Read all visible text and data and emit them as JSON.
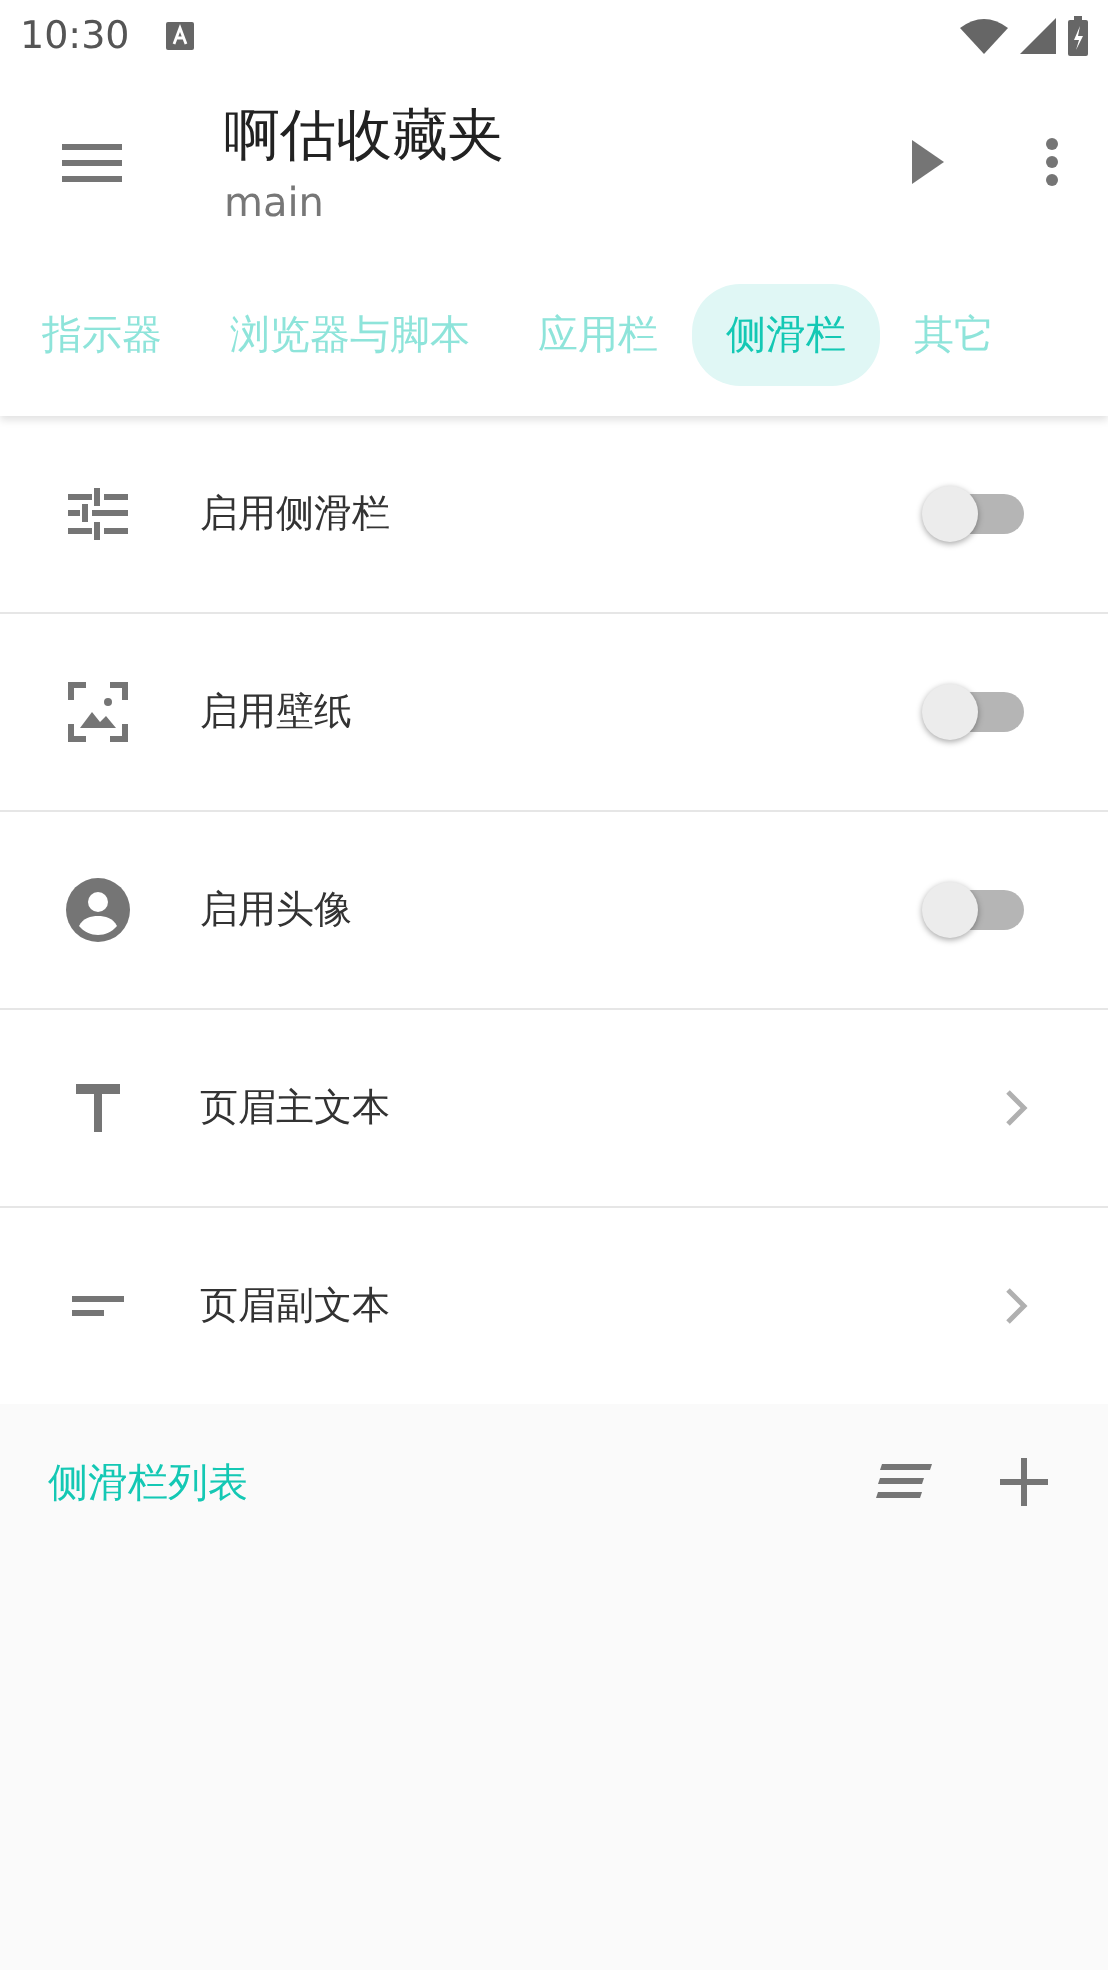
{
  "status_bar": {
    "time": "10:30"
  },
  "app_bar": {
    "title": "啊估收藏夹",
    "subtitle": "main"
  },
  "tabs": [
    {
      "label": "指示器",
      "selected": false
    },
    {
      "label": "浏览器与脚本",
      "selected": false
    },
    {
      "label": "应用栏",
      "selected": false
    },
    {
      "label": "侧滑栏",
      "selected": true
    },
    {
      "label": "其它",
      "selected": false
    }
  ],
  "settings": [
    {
      "kind": "toggle",
      "label": "启用侧滑栏",
      "on": false
    },
    {
      "kind": "toggle",
      "label": "启用壁纸",
      "on": false
    },
    {
      "kind": "toggle",
      "label": "启用头像",
      "on": false
    },
    {
      "kind": "link",
      "label": "页眉主文本"
    },
    {
      "kind": "link",
      "label": "页眉副文本"
    }
  ],
  "list_section": {
    "title": "侧滑栏列表"
  }
}
